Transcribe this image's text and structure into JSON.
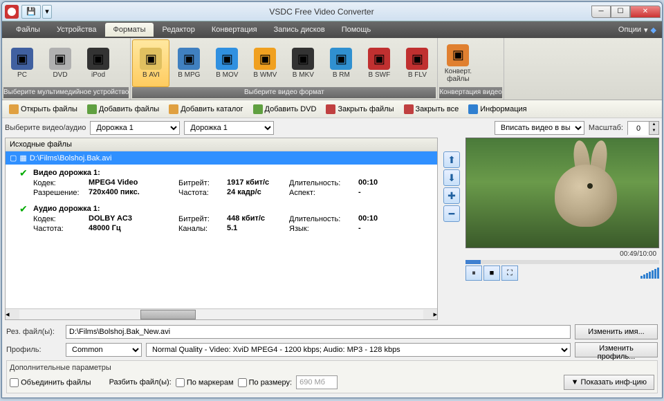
{
  "title": "VSDC Free Video Converter",
  "menu": {
    "items": [
      "Файлы",
      "Устройства",
      "Форматы",
      "Редактор",
      "Конвертация",
      "Запись дисков",
      "Помощь"
    ],
    "active": 2,
    "options": "Опции"
  },
  "ribbon": {
    "g1": {
      "caption": "Выберите мультимедийное устройство",
      "items": [
        {
          "l": "PC",
          "c": "#4060a0"
        },
        {
          "l": "DVD",
          "c": "#b0b0b0"
        },
        {
          "l": "iPod",
          "c": "#333"
        }
      ]
    },
    "g2": {
      "caption": "Выберите видео формат",
      "items": [
        {
          "l": "В AVI",
          "c": "#e0c060",
          "sel": true
        },
        {
          "l": "В MPG",
          "c": "#4080c0"
        },
        {
          "l": "В MOV",
          "c": "#3090e0"
        },
        {
          "l": "В WMV",
          "c": "#f0a020"
        },
        {
          "l": "В MKV",
          "c": "#333"
        },
        {
          "l": "В RM",
          "c": "#3090d0"
        },
        {
          "l": "В SWF",
          "c": "#c03030"
        },
        {
          "l": "В FLV",
          "c": "#c03030"
        }
      ]
    },
    "g3": {
      "caption": "Конвертация видео",
      "items": [
        {
          "l": "Конверт. файлы",
          "c": "#e08030"
        }
      ]
    }
  },
  "toolbar": [
    {
      "l": "Открыть файлы",
      "c": "#e0a040"
    },
    {
      "l": "Добавить файлы",
      "c": "#60a040"
    },
    {
      "l": "Добавить каталог",
      "c": "#e0a040"
    },
    {
      "l": "Добавить DVD",
      "c": "#60a040"
    },
    {
      "l": "Закрыть файлы",
      "c": "#c04040"
    },
    {
      "l": "Закрыть все",
      "c": "#c04040"
    },
    {
      "l": "Информация",
      "c": "#3080d0"
    }
  ],
  "selectRow": {
    "label": "Выберите видео/аудио",
    "track1": "Дорожка 1",
    "track2": "Дорожка 1"
  },
  "panel": {
    "header": "Исходные файлы",
    "file": "D:\\Films\\Bolshoj.Bak.avi",
    "video": {
      "title": "Видео дорожка 1:",
      "codec_l": "Кодек:",
      "codec": "MPEG4 Video",
      "res_l": "Разрешение:",
      "res": "720x400 пикс.",
      "br_l": "Битрейт:",
      "br": "1917 кбит/с",
      "fr_l": "Частота:",
      "fr": "24 кадр/с",
      "dur_l": "Длительность:",
      "dur": "00:10",
      "asp_l": "Аспект:",
      "asp": "-"
    },
    "audio": {
      "title": "Аудио дорожка 1:",
      "codec_l": "Кодек:",
      "codec": "DOLBY AC3",
      "fr_l": "Частота:",
      "fr": "48000 Гц",
      "br_l": "Битрейт:",
      "br": "448 кбит/с",
      "ch_l": "Каналы:",
      "ch": "5.1",
      "dur_l": "Длительность:",
      "dur": "00:10",
      "lang_l": "Язык:",
      "lang": "-"
    }
  },
  "preview": {
    "fit": "Вписать видео в выбр",
    "scale_l": "Масштаб:",
    "scale": "0",
    "time": "00:49/10:00"
  },
  "output": {
    "res_l": "Рез. файл(ы):",
    "res": "D:\\Films\\Bolshoj.Bak_New.avi",
    "btn_rename": "Изменить имя...",
    "prof_l": "Профиль:",
    "prof_cat": "Common",
    "prof": "Normal Quality - Video: XviD MPEG4 - 1200 kbps; Audio: MP3 - 128 kbps",
    "btn_prof": "Изменить профиль..."
  },
  "params": {
    "title": "Дополнительные параметры",
    "merge": "Объединить файлы",
    "split_l": "Разбить файл(ы):",
    "by_marker": "По маркерам",
    "by_size": "По размеру:",
    "size": "690 Мб",
    "show": "Показать инф-цию"
  }
}
